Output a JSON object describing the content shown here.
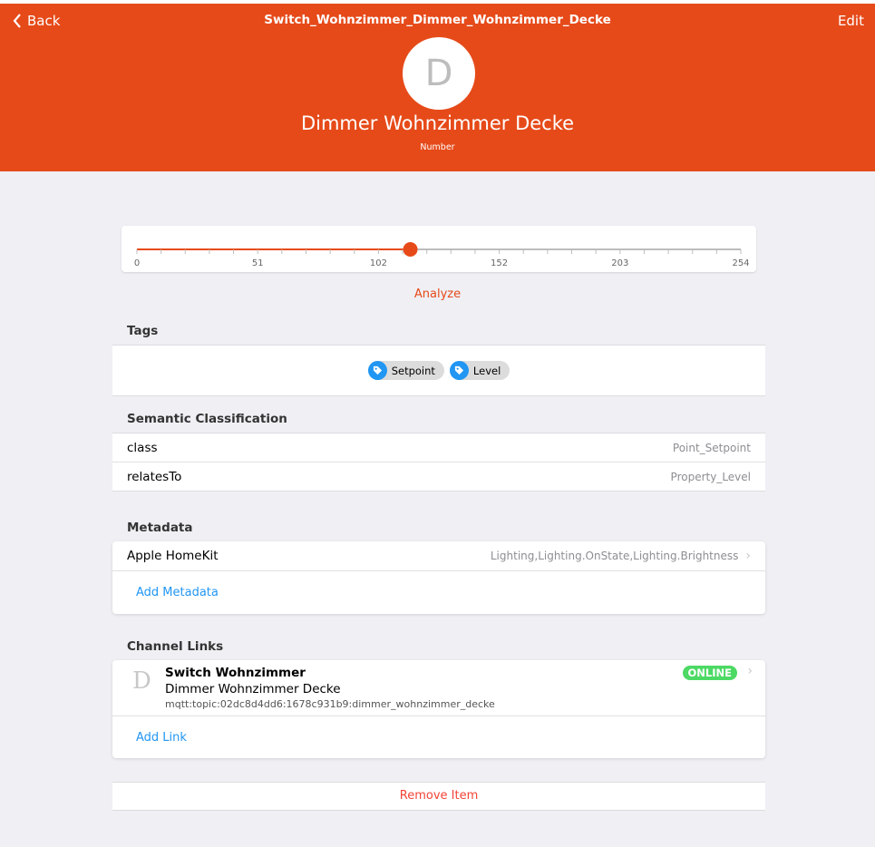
{
  "nav": {
    "back_label": "Back",
    "title": "Switch_Wohnzimmer_Dimmer_Wohnzimmer_Decke",
    "edit_label": "Edit"
  },
  "item": {
    "avatar_letter": "D",
    "label": "Dimmer Wohnzimmer Decke",
    "type": "Number"
  },
  "slider": {
    "min": 0,
    "max": 254,
    "value": 115,
    "tick_labels": [
      "0",
      "51",
      "102",
      "152",
      "203",
      "254"
    ],
    "accent": "#e64a19"
  },
  "analyze_label": "Analyze",
  "tags": {
    "title": "Tags",
    "items": [
      "Setpoint",
      "Level"
    ]
  },
  "semantic": {
    "title": "Semantic Classification",
    "rows": [
      {
        "key": "class",
        "value": "Point_Setpoint"
      },
      {
        "key": "relatesTo",
        "value": "Property_Level"
      }
    ]
  },
  "metadata": {
    "title": "Metadata",
    "rows": [
      {
        "key": "Apple HomeKit",
        "value": "Lighting,Lighting.OnState,Lighting.Brightness"
      }
    ],
    "add_label": "Add Metadata"
  },
  "channel_links": {
    "title": "Channel Links",
    "links": [
      {
        "letter": "D",
        "thing": "Switch Wohnzimmer",
        "channel": "Dimmer Wohnzimmer Decke",
        "uid": "mqtt:topic:02dc8d4dd6:1678c931b9:dimmer_wohnzimmer_decke",
        "status": "ONLINE"
      }
    ],
    "add_label": "Add Link"
  },
  "remove_label": "Remove Item",
  "colors": {
    "header": "#e64a19",
    "link": "#2196f3",
    "danger": "#f44336",
    "online": "#4cd964"
  }
}
